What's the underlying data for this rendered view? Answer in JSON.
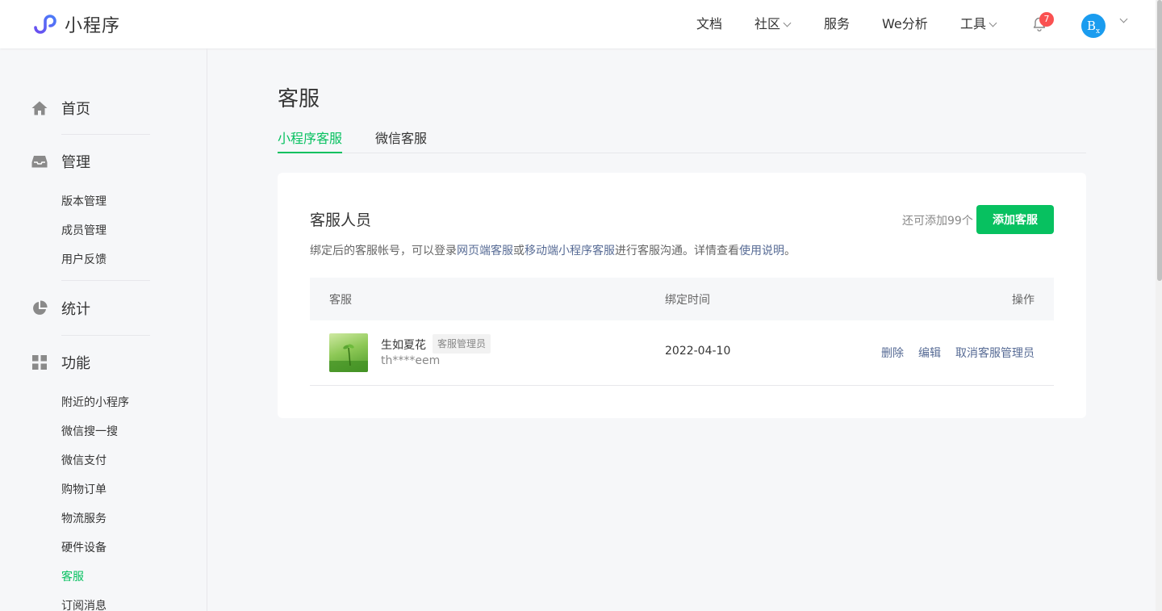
{
  "header": {
    "app_name": "小程序",
    "nav": [
      {
        "label": "文档",
        "has_dropdown": false
      },
      {
        "label": "社区",
        "has_dropdown": true
      },
      {
        "label": "服务",
        "has_dropdown": false
      },
      {
        "label": "We分析",
        "has_dropdown": false
      },
      {
        "label": "工具",
        "has_dropdown": true
      }
    ],
    "notification_count": "7",
    "avatar_text": "B",
    "avatar_sub": "x",
    "brand_color": "#07c160",
    "avatar_color": "#1a9cef",
    "badge_color": "#fa5151"
  },
  "sidebar": {
    "sections": [
      {
        "label": "首页",
        "icon": "home-icon"
      },
      {
        "label": "管理",
        "icon": "inbox-icon",
        "items": [
          "版本管理",
          "成员管理",
          "用户反馈"
        ]
      },
      {
        "label": "统计",
        "icon": "pie-chart-icon"
      },
      {
        "label": "功能",
        "icon": "grid-icon",
        "items": [
          "附近的小程序",
          "微信搜一搜",
          "微信支付",
          "购物订单",
          "物流服务",
          "硬件设备",
          "客服",
          "订阅消息"
        ]
      }
    ],
    "active_item": "客服"
  },
  "main": {
    "title": "客服",
    "tabs": [
      {
        "label": "小程序客服",
        "active": true
      },
      {
        "label": "微信客服",
        "active": false
      }
    ],
    "card": {
      "title": "客服人员",
      "remaining": "还可添加99个",
      "add_button": "添加客服",
      "desc_prefix": "绑定后的客服帐号，可以登录",
      "desc_link1": "网页端客服",
      "desc_or": "或",
      "desc_link2": "移动端小程序客服",
      "desc_mid": "进行客服沟通。详情查看",
      "desc_link3": "使用说明",
      "desc_end": "。",
      "table": {
        "columns": [
          "客服",
          "绑定时间",
          "操作"
        ],
        "rows": [
          {
            "name": "生如夏花",
            "role": "客服管理员",
            "account": "th****eem",
            "bind_time": "2022-04-10",
            "actions": [
              "删除",
              "编辑",
              "取消客服管理员"
            ]
          }
        ]
      }
    }
  }
}
